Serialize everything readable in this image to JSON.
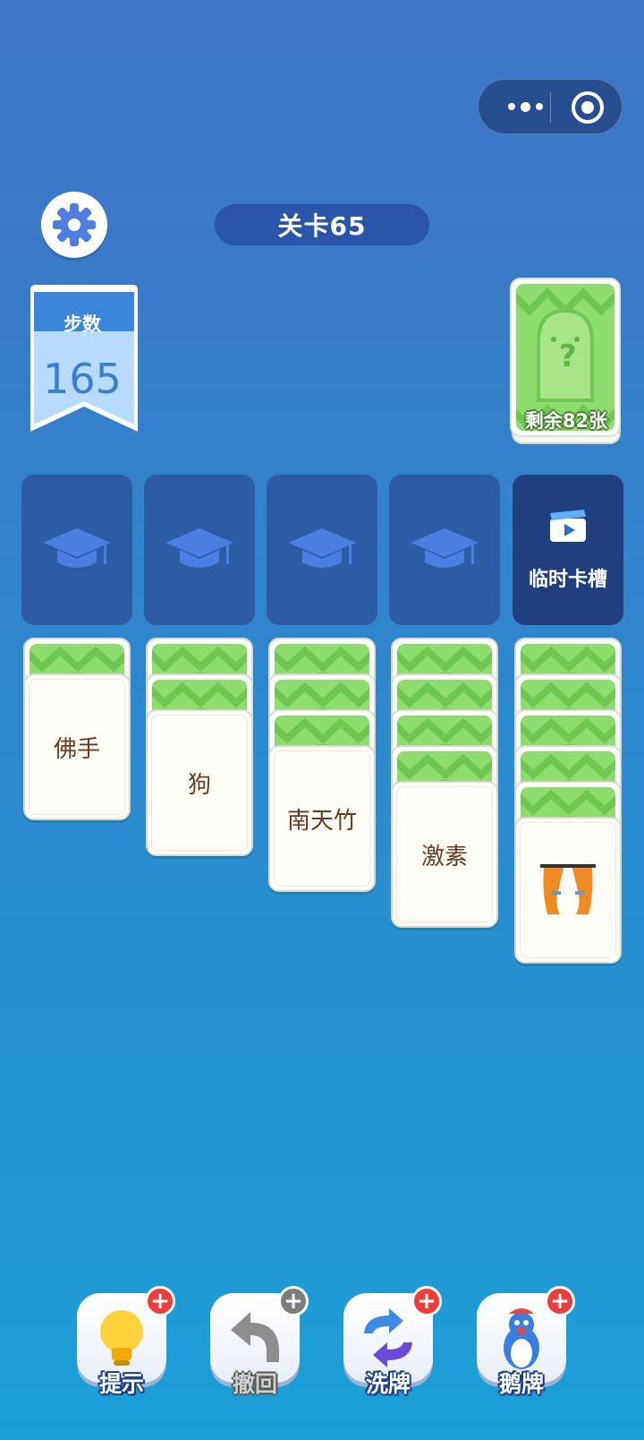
{
  "header": {
    "level_label": "关卡65",
    "steps_label": "步数",
    "steps_value": "165",
    "deck_remaining": "剩余82张"
  },
  "slots": {
    "temp_slot_label": "临时卡槽"
  },
  "piles": [
    {
      "face_text": "佛手"
    },
    {
      "face_text": "狗"
    },
    {
      "face_text": "南天竹"
    },
    {
      "face_text": "激素"
    },
    {
      "face_text": "",
      "face_icon": "curtain-icon"
    }
  ],
  "tools": {
    "hint_label": "提示",
    "undo_label": "撤回",
    "shuffle_label": "洗牌",
    "goose_label": "鹅牌"
  },
  "colors": {
    "card_back_green": "#8fdc6e",
    "slot_blue": "#2d5ba6",
    "temp_slot_navy": "#1f3f7e",
    "badge_red": "#ef3b3b",
    "card_text_brown": "#6b3a22"
  }
}
